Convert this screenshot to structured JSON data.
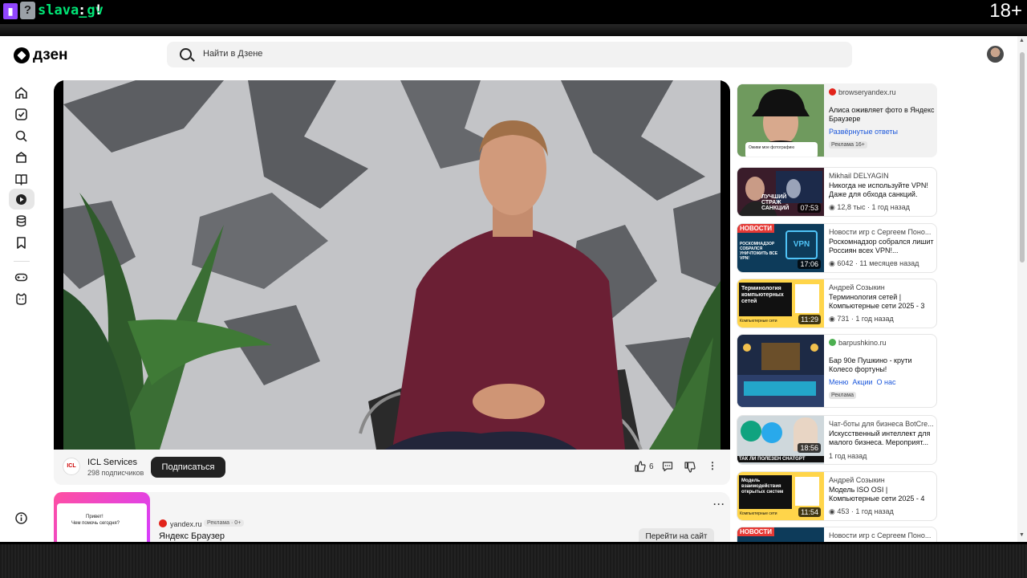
{
  "stream": {
    "chat_username": "slava_gv",
    "chat_message": ": !",
    "badge_char": "?",
    "age_label": "18+"
  },
  "header": {
    "logo_text": "дзен",
    "search_placeholder": "Найти в Дзене"
  },
  "channel": {
    "logo_text": "ICL",
    "name": "ICL Services",
    "subscribers": "298 подписчиков",
    "subscribe_label": "Подписаться",
    "likes": "6"
  },
  "ad_below": {
    "thumb_line1": "Привет!",
    "thumb_line2": "Чем помочь сегодня?",
    "source": "yandex.ru",
    "tag": "Реклама · 0+",
    "title": "Яндекс Браузер",
    "cta": "Перейти на сайт"
  },
  "sidebar_cards": [
    {
      "channel": "browseryandex.ru",
      "title": "Алиса оживляет фото в Яндекс Браузере",
      "link": "Развёрнутые ответы",
      "tag": "Реклама 16+",
      "thumb_caption": "Оживи мое фотографию"
    },
    {
      "channel": "Mikhail DELYAGIN",
      "title": "Никогда не используйте VPN! Даже для обхода санкций.",
      "meta": "◉ 12,8 тыс · 1 год назад",
      "duration": "07:53",
      "thumb_text": "ЛУЧШИЙ СТРАЖ САНКЦИЙ"
    },
    {
      "channel": "Новости игр с Сергеем Поно...",
      "title": "Роскомнадзор собрался лишит Россиян всех VPN!...",
      "meta": "◉ 6042 · 11 месяцев назад",
      "duration": "17:06",
      "thumb_text": "НОВОСТИ",
      "thumb_text2": "РОСКОМНАДЗОР СОБРАЛСЯ УНИЧТОЖИТЬ ВСЕ VPN!"
    },
    {
      "channel": "Андрей Созыкин",
      "title": "Терминология сетей | Компьютерные сети 2025 - 3",
      "meta": "◉ 731 · 1 год назад",
      "duration": "11:29",
      "thumb_text": "Терминология компьютерных сетей",
      "thumb_text2": "Компьютерные сети"
    },
    {
      "channel": "barpushkino.ru",
      "title": "Бар 90е Пушкино - крути Колесо фортуны!",
      "links": [
        "Меню",
        "Акции",
        "О нас"
      ],
      "tag": "Реклама"
    },
    {
      "channel": "Чат-боты для бизнеса BotCre...",
      "title": "Искусственный интеллект для малого бизнеса. Мероприят...",
      "meta": "1 год назад",
      "duration": "18:56",
      "thumb_text": "ТАК ЛИ ПОЛЕЗЕН CHATGPT"
    },
    {
      "channel": "Андрей Созыкин",
      "title": "Модель ISO OSI | Компьютерные сети 2025 - 4",
      "meta": "◉ 453 · 1 год назад",
      "duration": "11:54",
      "thumb_text": "Модель взаимодействия открытых систем",
      "thumb_text2": "Компьютерные сети"
    },
    {
      "channel": "Новости игр с Сергеем Поно...",
      "thumb_text": "НОВОСТИ"
    }
  ],
  "colors": {
    "accent_link": "#1a56db",
    "subscribe_bg": "#222222",
    "chat_name": "#00e676",
    "twitch": "#9146ff"
  }
}
